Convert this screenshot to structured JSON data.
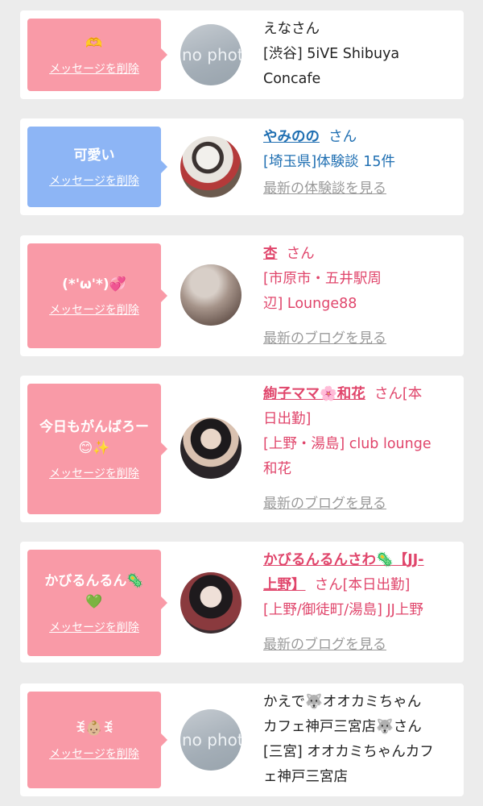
{
  "delete_label": "メッセージを削除",
  "san_label": "さん",
  "items": [
    {
      "message": "🫶",
      "avatar_text": "no photo",
      "name": "えなさん",
      "line1": "[渋谷] 5iVE Shibuya",
      "line2": "Concafe"
    },
    {
      "message": "可愛い",
      "name": "やみのの",
      "detail": "[埼玉県]体験談 15件",
      "link": "最新の体験談を見る"
    },
    {
      "message": "(*'ω'*)💞",
      "name": "杏",
      "detail1": "[市原市・五井駅周",
      "detail2": "辺] Lounge88",
      "link": "最新のブログを見る"
    },
    {
      "message1": "今日もがんばろー",
      "message2": "😊✨",
      "name": "絢子ママ🌸和花",
      "suffix": "さん[本",
      "suffix2": "日出勤]",
      "detail1": "[上野・湯島] club lounge",
      "detail2": "和花",
      "link": "最新のブログを見る"
    },
    {
      "message1": "かびるんるん🦠",
      "message2": "💚",
      "name1": "かびるんるんさわ🦠【JJ-",
      "name2": "上野】",
      "suffix": "さん[本日出勤]",
      "detail": "[上野/御徒町/湯島] JJ上野",
      "link": "最新のブログを見る"
    },
    {
      "message": "ꉂ👶🏼ꉂ",
      "avatar_text": "no photo",
      "name1": "かえで🐺オオカミちゃん",
      "name2": "カフェ神戸三宮店🐺さん",
      "line1": "[三宮] オオカミちゃんカフ",
      "line2": "ェ神戸三宮店"
    }
  ],
  "colors": {
    "pink_bubble": "#f99aa7",
    "blue_bubble": "#8db5f5",
    "blue_link": "#1f6fb2",
    "pink_link": "#e0456b"
  }
}
